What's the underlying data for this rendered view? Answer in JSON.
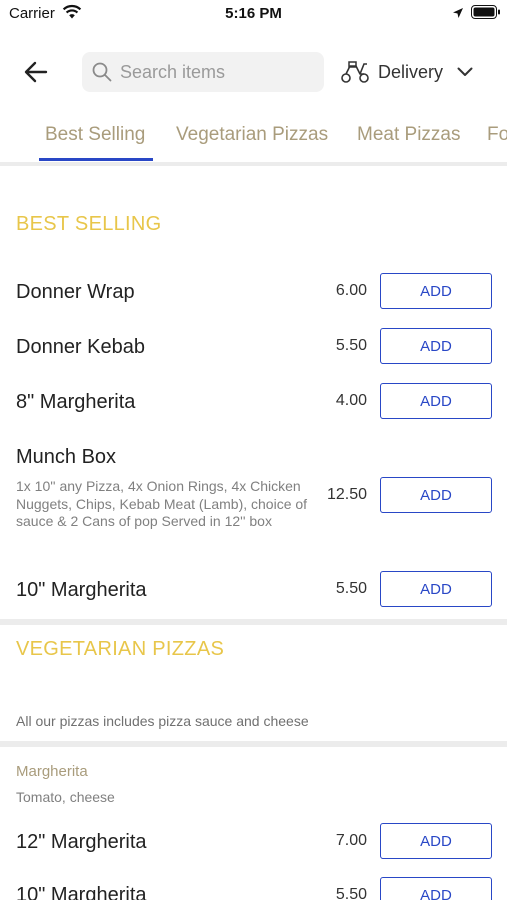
{
  "status_bar": {
    "carrier": "Carrier",
    "time": "5:16 PM"
  },
  "header": {
    "back_icon": "arrow-left-icon",
    "search": {
      "placeholder": "Search items",
      "value": "",
      "icon": "search-icon"
    },
    "delivery": {
      "label": "Delivery",
      "icon": "scooter-icon",
      "chevron": "chevron-down-icon"
    }
  },
  "tabs": [
    {
      "label": "Best Selling",
      "active": true
    },
    {
      "label": "Vegetarian Pizzas",
      "active": false
    },
    {
      "label": "Meat Pizzas",
      "active": false
    },
    {
      "label": "Fo",
      "active": false
    }
  ],
  "colors": {
    "accent": "#2947c6",
    "section_title": "#e8c64a",
    "tab_text": "#a99c7c"
  },
  "sections": [
    {
      "title": "BEST SELLING",
      "items": [
        {
          "name": "Donner Wrap",
          "price": "6.00",
          "button": "ADD"
        },
        {
          "name": "Donner Kebab",
          "price": "5.50",
          "button": "ADD"
        },
        {
          "name": "8\" Margherita",
          "price": "4.00",
          "button": "ADD"
        },
        {
          "name": "Munch Box",
          "description": "1x 10'' any Pizza, 4x Onion Rings, 4x Chicken Nuggets, Chips, Kebab Meat (Lamb), choice of sauce & 2 Cans of pop Served in 12'' box",
          "price": "12.50",
          "button": "ADD"
        },
        {
          "name": "10\" Margherita",
          "price": "5.50",
          "button": "ADD"
        }
      ]
    },
    {
      "title": "VEGETARIAN PIZZAS",
      "note": "All our pizzas includes pizza sauce and cheese",
      "subgroup": {
        "title": "Margherita",
        "description": "Tomato, cheese"
      },
      "items": [
        {
          "name": "12\" Margherita",
          "price": "7.00",
          "button": "ADD"
        },
        {
          "name": "10\" Margherita",
          "price": "5.50",
          "button": "ADD"
        }
      ]
    }
  ]
}
